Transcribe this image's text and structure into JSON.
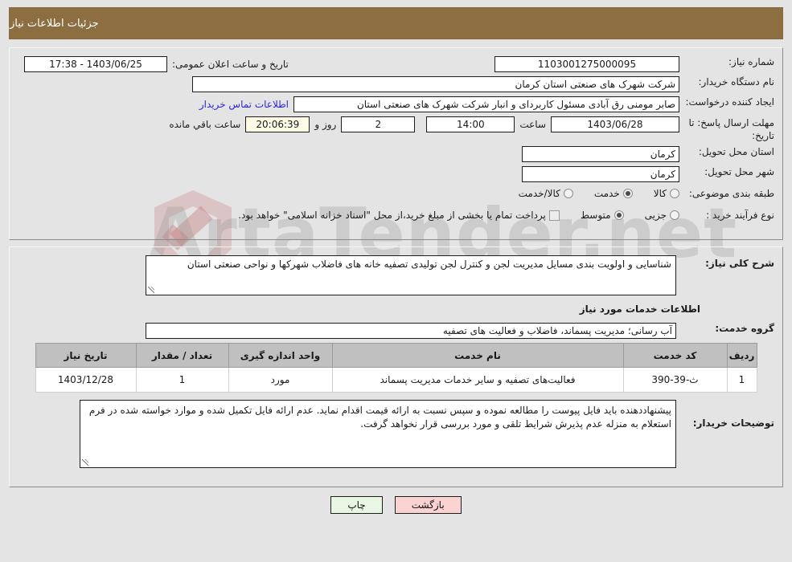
{
  "header": {
    "title": "جزئیات اطلاعات نیاز"
  },
  "form": {
    "need_number_label": "شماره نیاز:",
    "need_number_value": "1103001275000095",
    "announce_datetime_label": "تاریخ و ساعت اعلان عمومی:",
    "announce_datetime_value": "17:38 - 1403/06/25",
    "buyer_org_label": "نام دستگاه خریدار:",
    "buyer_org_value": "شرکت شهرک های صنعتی استان کرمان",
    "requester_label": "ایجاد کننده درخواست:",
    "requester_value": "صابر مومنی رق آبادی مسئول کاربردای و انبار شرکت شهرک های صنعتی استان",
    "buyer_contact_link": "اطلاعات تماس خریدار",
    "deadline_label": "مهلت ارسال پاسخ: تا تاریخ:",
    "deadline_date": "1403/06/28",
    "time_label": "ساعت",
    "deadline_time": "14:00",
    "days_remaining": "2",
    "days_and_label": "روز و",
    "hours_remaining": "20:06:39",
    "remaining_suffix": "ساعت باقي مانده",
    "delivery_province_label": "استان محل تحویل:",
    "delivery_province_value": "کرمان",
    "delivery_city_label": "شهر محل تحویل:",
    "delivery_city_value": "کرمان",
    "category_label": "طبقه بندی موضوعی:",
    "category_options": [
      {
        "label": "کالا",
        "selected": false
      },
      {
        "label": "خدمت",
        "selected": true
      },
      {
        "label": "کالا/خدمت",
        "selected": false
      }
    ],
    "process_label": "نوع فرآیند خرید :",
    "process_options": [
      {
        "label": "جزیی",
        "selected": false
      },
      {
        "label": "متوسط",
        "selected": true
      }
    ],
    "treasury_checkbox_checked": false,
    "treasury_note": "پرداخت تمام یا بخشی از مبلغ خرید،از محل \"اسناد خزانه اسلامی\" خواهد بود."
  },
  "details": {
    "general_desc_label": "شرح کلی نیاز:",
    "general_desc_value": "شناسایی و اولویت بندی مسایل مدیریت لجن و کنترل لجن تولیدی تصفیه خانه های فاضلاب شهرکها و نواحی صنعتی استان",
    "services_info_title": "اطلاعات خدمات مورد نیاز",
    "service_group_label": "گروه خدمت:",
    "service_group_value": "آب رسانی؛ مدیریت پسماند، فاضلاب و فعالیت های تصفیه"
  },
  "table": {
    "columns": [
      "ردیف",
      "کد خدمت",
      "نام خدمت",
      "واحد اندازه گیری",
      "تعداد / مقدار",
      "تاریخ نیاز"
    ],
    "rows": [
      {
        "index": "1",
        "code": "ث-39-390",
        "name": "فعالیت‌های تصفیه و سایر خدمات مدیریت پسماند",
        "unit": "مورد",
        "quantity": "1",
        "need_date": "1403/12/28"
      }
    ]
  },
  "buyer_notes": {
    "label": "توضیحات خریدار:",
    "value": "پیشنهاددهنده باید فایل پیوست را مطالعه نموده و سپس نسبت به ارائه قیمت اقدام نماید. عدم ارائه فایل تکمیل شده و موارد خواسته شده در فرم استعلام به منزله عدم پذیرش شرایط تلقی و مورد بررسی قرار نخواهد گرفت."
  },
  "footer": {
    "back_label": "بازگشت",
    "print_label": "چاپ"
  },
  "watermark": {
    "text": "ArtaTender.net",
    "shield": "shield-check-logo"
  },
  "colors": {
    "header_brown": "#8d6e41",
    "table_header_gray": "#c0c0c0",
    "link_blue": "#2a2ad0",
    "back_button_pink": "#fbd2d2",
    "print_button_green": "#e9f6e4",
    "timer_cream": "#fbfbe6",
    "service_name_orange": "#b85c00"
  }
}
